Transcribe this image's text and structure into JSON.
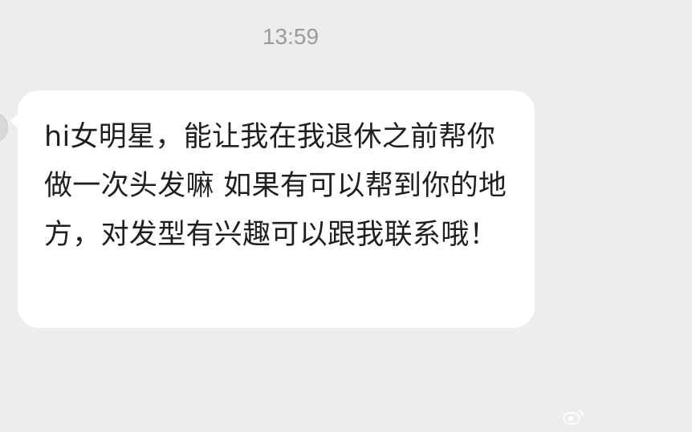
{
  "chat": {
    "timestamp": "13:59",
    "message": {
      "text": "hi女明星，能让我在我退休之前帮你做一次头发嘛 如果有可以帮到你的地方，对发型有兴趣可以跟我联系哦！"
    }
  },
  "colors": {
    "background": "#ededed",
    "bubble": "#ffffff",
    "text": "#1f1f1f",
    "timestamp": "#9a9a9a"
  }
}
